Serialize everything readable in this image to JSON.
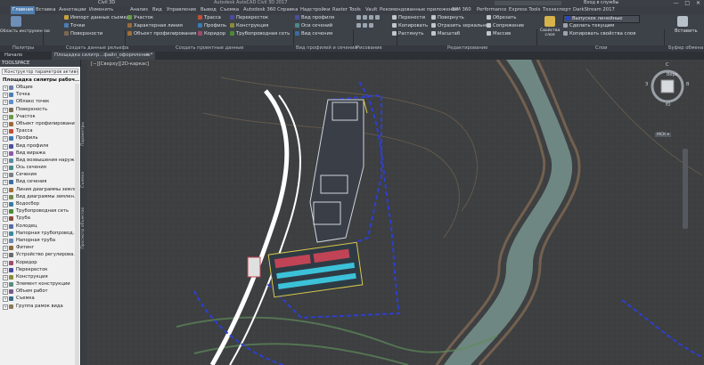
{
  "titlebar": {
    "app_title": "Civil 3D",
    "file_title": "Autodesk AutoCAD Civil 3D 2017",
    "search_placeholder": "Введите ключевое слово/фразу",
    "login": "Вход в службы",
    "min": "—",
    "max": "□",
    "close": "✕"
  },
  "ribbon_tabs": [
    "Главная",
    "Вставка",
    "Аннотации",
    "Изменить",
    "Анализ",
    "Вид",
    "Управление",
    "Вывод",
    "Съемка",
    "Autodesk 360",
    "Справка",
    "Надстройки",
    "Raster Tools",
    "Vault",
    "Рекомендованные приложения",
    "BIM 360",
    "Performance",
    "Express Tools",
    "Техэксперт",
    "DarkStream 2017"
  ],
  "ribbon": {
    "toolspace_btn": "Область инструментов",
    "import_survey": "Импорт данных съемки",
    "points": "Точки",
    "surfaces": "Поверхности",
    "parcels": "Участок",
    "feature_lines": "Характерная линия",
    "grading": "Объект профилирования",
    "alignment": "Трасса",
    "profile": "Профиль",
    "corridor": "Коридор",
    "intersection": "Перекресток",
    "assembly": "Конструкция",
    "pipe_network": "Трубопроводная сеть",
    "profile_view": "Вид профиля",
    "sample_lines": "Оси сечений",
    "section_views": "Вид сечения",
    "move": "Перенести",
    "copy": "Копировать",
    "stretch": "Растянуть",
    "rotate": "Повернуть",
    "mirror": "Отразить зеркально",
    "scale": "Масштаб",
    "trim": "Обрезать",
    "fillet": "Сопряжение",
    "array": "Массив",
    "properties": "Свойства слоя",
    "layer_current": "Сделать текущим",
    "copy_layer_props": "Копировать свойства слоя",
    "paste": "Вставить",
    "layer_value": "Выпускек линейные"
  },
  "panel_titles": [
    "Палитры",
    "Создать данные рельефа",
    "Создать проектные данные",
    "Вид профилей и сечений",
    "Рисование",
    "Редактирование",
    "Слои",
    "Буфер обмена"
  ],
  "doc_tabs": [
    "Начало",
    "Площадка силитр...файл_оформление*"
  ],
  "toolspace": {
    "title": "TOOLSPACE",
    "dropdown": "Конструктор параметров активного чертежа",
    "root": "Площадка силитры рабоч...",
    "items": [
      {
        "label": "Общие",
        "color": "#6a7fa8"
      },
      {
        "label": "Точка",
        "color": "#4a7fb5"
      },
      {
        "label": "Облако точек",
        "color": "#5d8fc9"
      },
      {
        "label": "Поверхность",
        "color": "#7a6a50"
      },
      {
        "label": "Участок",
        "color": "#6b9c4a"
      },
      {
        "label": "Объект профилирования",
        "color": "#9b6b3c"
      },
      {
        "label": "Трасса",
        "color": "#c0503a"
      },
      {
        "label": "Профиль",
        "color": "#3c7ab5"
      },
      {
        "label": "Вид профиля",
        "color": "#4a4f9e"
      },
      {
        "label": "Вид виража",
        "color": "#8b5aa6"
      },
      {
        "label": "Вид возвышения наруж...",
        "color": "#5a8aa6"
      },
      {
        "label": "Ось сечения",
        "color": "#4a8a8a"
      },
      {
        "label": "Сечения",
        "color": "#7a7f86"
      },
      {
        "label": "Вид сечения",
        "color": "#3a6aa0"
      },
      {
        "label": "Линия диаграммы земля...",
        "color": "#a0703a"
      },
      {
        "label": "Вид диаграммы землен...",
        "color": "#708a4a"
      },
      {
        "label": "Водосбор",
        "color": "#3a7aa0"
      },
      {
        "label": "Трубопроводная сеть",
        "color": "#4a8a3a"
      },
      {
        "label": "Труба",
        "color": "#8a4a3a"
      },
      {
        "label": "Колодец",
        "color": "#5a6aa0"
      },
      {
        "label": "Напорная трубопровод...",
        "color": "#3a8aa0"
      },
      {
        "label": "Напорная труба",
        "color": "#6a8ab0"
      },
      {
        "label": "Фитинг",
        "color": "#8a6a3a"
      },
      {
        "label": "Устройство регулирова...",
        "color": "#6a6a6a"
      },
      {
        "label": "Коридор",
        "color": "#a04a6a"
      },
      {
        "label": "Перекресток",
        "color": "#4a4aa0"
      },
      {
        "label": "Конструкция",
        "color": "#8a8a3a"
      },
      {
        "label": "Элемент конструкции",
        "color": "#5a8a7a"
      },
      {
        "label": "Объем работ",
        "color": "#7a5a8a"
      },
      {
        "label": "Съемка",
        "color": "#3a6a8a"
      },
      {
        "label": "Группа рамок вида",
        "color": "#8a7a5a"
      }
    ]
  },
  "side_labels": [
    "Параметры",
    "Съемка",
    "Просмотр объектов"
  ],
  "canvas": {
    "view_label": "[−][Сверху][2D-каркас]",
    "viewcube_top": "Верх",
    "north": "С",
    "south": "Ю",
    "west": "З",
    "east": "В",
    "wcs": "МСК ▾"
  }
}
